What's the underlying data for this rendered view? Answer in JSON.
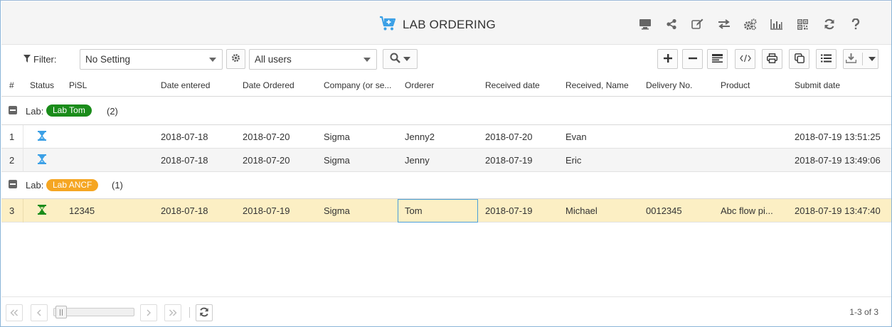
{
  "header": {
    "title": "LAB ORDERING",
    "title_icon": "cart-plus-icon",
    "icons": [
      "monitor-icon",
      "share-icon",
      "edit-icon",
      "exchange-icon",
      "cogs-icon",
      "bar-chart-icon",
      "qrcode-icon",
      "refresh-icon",
      "help-icon"
    ]
  },
  "toolbar": {
    "filter_label": "Filter:",
    "setting_value": "No Setting",
    "users_value": "All users",
    "right_buttons": [
      "plus-icon",
      "minus-icon",
      "view-icon",
      "code-icon",
      "print-icon",
      "copy-icon",
      "list-icon",
      "download-icon"
    ]
  },
  "columns": {
    "num": "#",
    "status": "Status",
    "pisl": "PiSL",
    "date_entered": "Date entered",
    "date_ordered": "Date Ordered",
    "company": "Company (or se...",
    "orderer": "Orderer",
    "received_date": "Received date",
    "received_name": "Received, Name",
    "delivery_no": "Delivery No.",
    "product": "Product",
    "submit_date": "Submit date"
  },
  "groups": [
    {
      "label": "Lab:",
      "name": "Lab Tom",
      "count": "(2)",
      "color": "#1a8c1a",
      "rows": [
        {
          "num": "1",
          "status": "hourglass-blue",
          "pisl": "",
          "date_entered": "2018-07-18",
          "date_ordered": "2018-07-20",
          "company": "Sigma",
          "orderer": "Jenny2",
          "received_date": "2018-07-20",
          "received_name": "Evan",
          "delivery_no": "",
          "product": "",
          "submit_date": "2018-07-19 13:51:25"
        },
        {
          "num": "2",
          "status": "hourglass-blue",
          "pisl": "",
          "date_entered": "2018-07-18",
          "date_ordered": "2018-07-20",
          "company": "Sigma",
          "orderer": "Jenny",
          "received_date": "2018-07-19",
          "received_name": "Eric",
          "delivery_no": "",
          "product": "",
          "submit_date": "2018-07-19 13:49:06"
        }
      ]
    },
    {
      "label": "Lab:",
      "name": "Lab ANCF",
      "count": "(1)",
      "color": "#f5a623",
      "rows": [
        {
          "num": "3",
          "status": "hourglass-green",
          "pisl": "12345",
          "date_entered": "2018-07-18",
          "date_ordered": "2018-07-19",
          "company": "Sigma",
          "orderer": "Tom",
          "received_date": "2018-07-19",
          "received_name": "Michael",
          "delivery_no": "0012345",
          "product": "Abc flow pi...",
          "submit_date": "2018-07-19 13:47:40"
        }
      ]
    }
  ],
  "footer": {
    "pager_text": "1-3 of 3"
  },
  "colors": {
    "accent_blue": "#3ba0e6",
    "selected_row": "#fcefc4",
    "alt_row": "#f5f5f5",
    "lab_tom": "#1a8c1a",
    "lab_ancf": "#f5a623"
  }
}
